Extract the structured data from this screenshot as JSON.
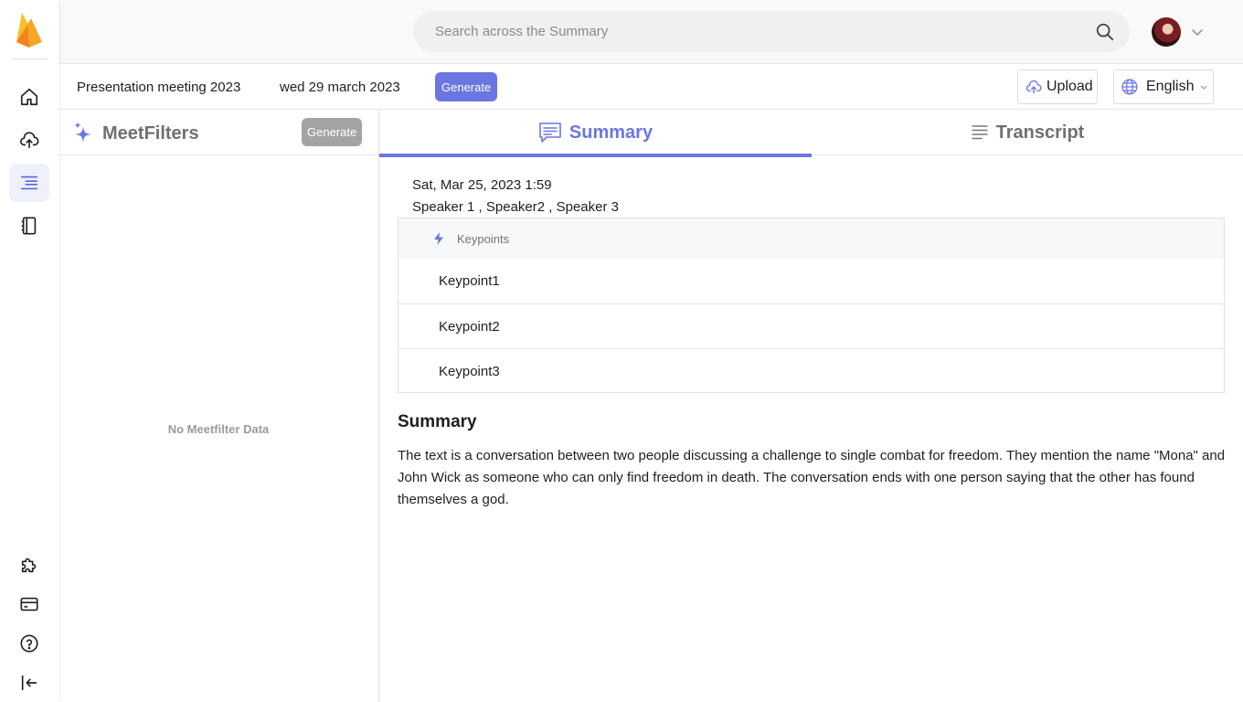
{
  "header": {
    "search_placeholder": "Search across the Summary"
  },
  "subheader": {
    "meeting_title": "Presentation meeting 2023",
    "meeting_date": "wed 29 march 2023",
    "generate_label": "Generate",
    "upload_label": "Upload",
    "language_label": "English"
  },
  "sidebar": {
    "items": [
      {
        "name": "home-icon"
      },
      {
        "name": "upload-cloud-icon"
      },
      {
        "name": "summary-list-icon",
        "active": true
      },
      {
        "name": "notebook-icon"
      },
      {
        "name": "puzzle-icon"
      },
      {
        "name": "card-icon"
      },
      {
        "name": "help-icon"
      },
      {
        "name": "logout-icon"
      }
    ]
  },
  "meetfilters": {
    "title": "MeetFilters",
    "generate_label": "Generate",
    "empty_text": "No Meetfilter Data"
  },
  "tabs": [
    {
      "label": "Summary",
      "active": true
    },
    {
      "label": "Transcript",
      "active": false
    }
  ],
  "summary": {
    "datetime": "Sat, Mar 25, 2023 1:59",
    "speakers": "Speaker 1 , Speaker2 , Speaker 3",
    "keypoints_header": "Keypoints",
    "keypoints": [
      "Keypoint1",
      "Keypoint2",
      "Keypoint3"
    ],
    "title": "Summary",
    "text": "The text is a conversation between two people discussing a challenge to single combat for freedom. They mention the name \"Mona\" and John Wick as someone who can only find freedom in death. The conversation ends with one person saying that the other has found themselves a god."
  },
  "colors": {
    "accent": "#6b76e3",
    "logo_orange": "#f6a623",
    "muted_button": "#a3a3a3"
  }
}
